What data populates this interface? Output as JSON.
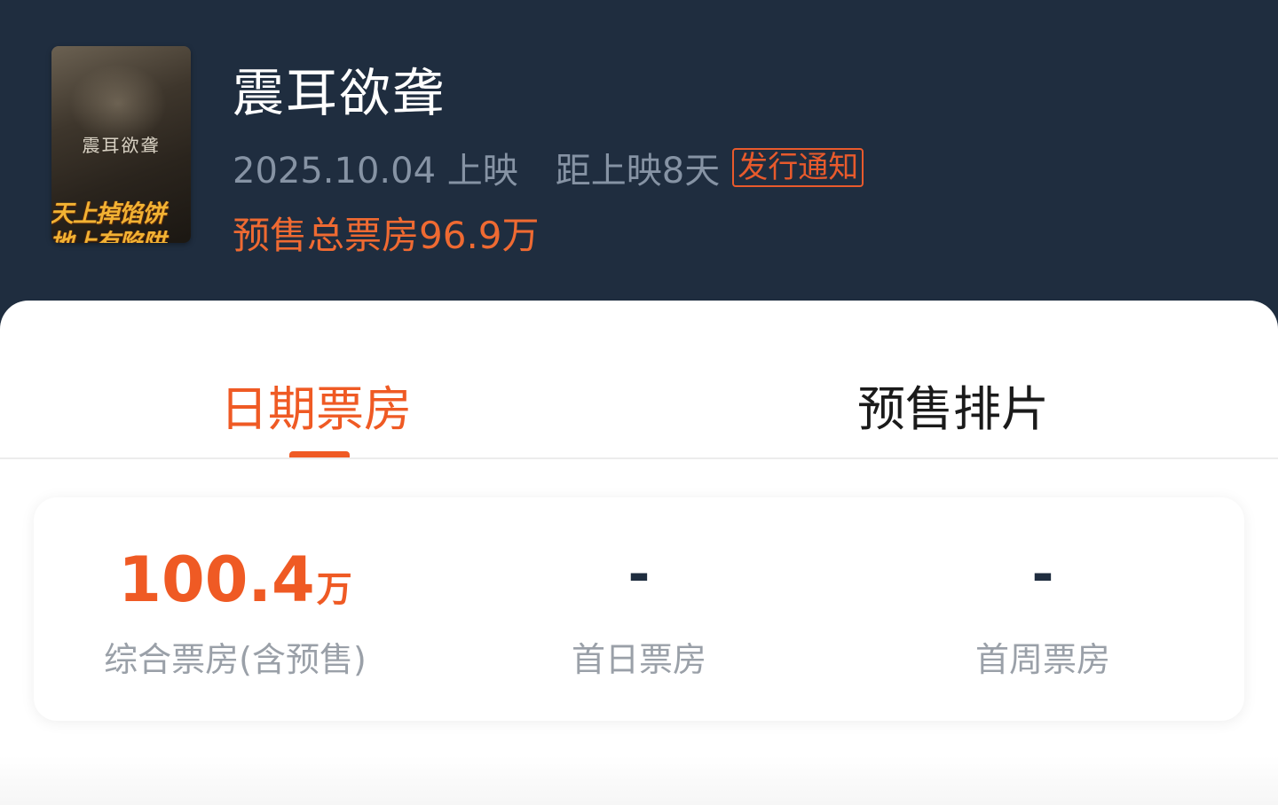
{
  "movie": {
    "title": "震耳欲聋",
    "release_date": "2025.10.04 上映",
    "countdown": "距上映8天",
    "notice_label": "发行通知",
    "presale_total": "预售总票房96.9万",
    "poster": {
      "title": "震耳欲聋",
      "tagline_1": "天上掉馅饼",
      "tagline_2": "地上有陷阱"
    }
  },
  "tabs": [
    {
      "label": "日期票房",
      "active": true
    },
    {
      "label": "预售排片",
      "active": false
    }
  ],
  "stats": [
    {
      "value": "100.4",
      "unit": "万",
      "label": "综合票房(含预售)"
    },
    {
      "value": "-",
      "label": "首日票房"
    },
    {
      "value": "-",
      "label": "首周票房"
    }
  ],
  "colors": {
    "header_bg": "#1f2d3f",
    "accent": "#ef5a24",
    "muted_text": "#8693a4",
    "label_text": "#9aa0a8"
  }
}
